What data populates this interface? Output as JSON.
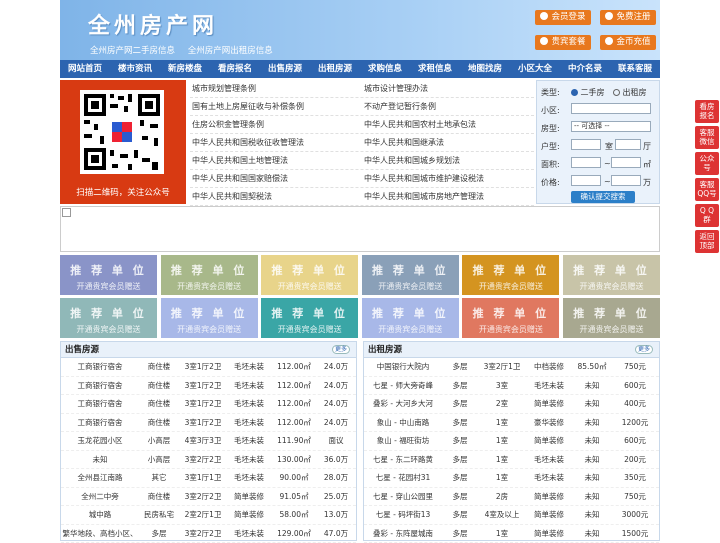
{
  "header": {
    "logo": "全州房产网",
    "taglines": [
      "全州房产网二手房信息",
      "全州房产网出租房信息"
    ],
    "buttons": [
      "会员登录",
      "免费注册",
      "贵宾套餐",
      "金币充值"
    ]
  },
  "nav": [
    "网站首页",
    "楼市资讯",
    "新房楼盘",
    "看房报名",
    "出售房源",
    "出租房源",
    "求购信息",
    "求租信息",
    "地图找房",
    "小区大全",
    "中介名录",
    "联系客服"
  ],
  "qr": {
    "caption": "扫描二维码，关注公众号"
  },
  "links": [
    [
      "城市规划管理条例",
      "城市设计管理办法"
    ],
    [
      "国有土地上房屋征收与补偿条例",
      "不动产登记暂行条例"
    ],
    [
      "住房公积金管理条例",
      "中华人民共和国农村土地承包法"
    ],
    [
      "中华人民共和国税收征收管理法",
      "中华人民共和国继承法"
    ],
    [
      "中华人民共和国土地管理法",
      "中华人民共和国城乡规划法"
    ],
    [
      "中华人民共和国国家赔偿法",
      "中华人民共和国城市维护建设税法"
    ],
    [
      "中华人民共和国契税法",
      "中华人民共和国城市房地产管理法"
    ]
  ],
  "search": {
    "type_label": "类型:",
    "opt1": "二手房",
    "opt2": "出租房",
    "community_label": "小区:",
    "housetype_label": "房型:",
    "select_any": "-- 可选择 --",
    "layout_label": "户型:",
    "room": "室",
    "hall": "厅",
    "area_label": "面积:",
    "area_unit": "㎡",
    "price_label": "价格:",
    "price_unit": "万",
    "submit": "确认提交搜索"
  },
  "ads": {
    "line1": "推 荐 单 位",
    "line2": "开通贵宾会员赠送",
    "colors": [
      "#8a94c8",
      "#a8b88a",
      "#e8d48a",
      "#8aa0b8",
      "#d49420",
      "#c8c4a8",
      "#90b8b8",
      "#a8b8e8",
      "#3aa6a6",
      "#a8b8e8",
      "#e07860",
      "#a8a890"
    ]
  },
  "sale": {
    "title": "出售房源",
    "more": "更多",
    "rows": [
      [
        "工商银行宿舍",
        "商住楼",
        "3室1厅2卫",
        "毛坯未装",
        "112.00㎡",
        "24.0万"
      ],
      [
        "工商银行宿舍",
        "商住楼",
        "3室1厅2卫",
        "毛坯未装",
        "112.00㎡",
        "24.0万"
      ],
      [
        "工商银行宿舍",
        "商住楼",
        "3室1厅2卫",
        "毛坯未装",
        "112.00㎡",
        "24.0万"
      ],
      [
        "工商银行宿舍",
        "商住楼",
        "3室1厅2卫",
        "毛坯未装",
        "112.00㎡",
        "24.0万"
      ],
      [
        "玉龙花园小区",
        "小高层",
        "4室3厅3卫",
        "毛坯未装",
        "111.90㎡",
        "面议"
      ],
      [
        "未知",
        "小高层",
        "3室2厅2卫",
        "毛坯未装",
        "130.00㎡",
        "36.0万"
      ],
      [
        "全州县江南路",
        "其它",
        "3室1厅1卫",
        "毛坯未装",
        "90.00㎡",
        "28.0万"
      ],
      [
        "全州二中旁",
        "商住楼",
        "3室2厅2卫",
        "简单装修",
        "91.05㎡",
        "25.0万"
      ],
      [
        "城中路",
        "民房私宅",
        "2室2厅1卫",
        "简单装修",
        "58.00㎡",
        "13.0万"
      ],
      [
        "繁华地段、高档小区、",
        "多层",
        "3室2厅2卫",
        "毛坯未装",
        "129.00㎡",
        "47.0万"
      ]
    ]
  },
  "rent": {
    "title": "出租房源",
    "more": "更多",
    "rows": [
      [
        "中国银行大院内",
        "多层",
        "3室2厅1卫",
        "中档装修",
        "85.50㎡",
        "750元"
      ],
      [
        "七星 - 师大旁奇峰",
        "多层",
        "3室",
        "毛坯未装",
        "未知",
        "600元"
      ],
      [
        "叠彩 - 大河乡大河",
        "多层",
        "2室",
        "简单装修",
        "未知",
        "400元"
      ],
      [
        "象山 - 中山南路",
        "多层",
        "1室",
        "豪华装修",
        "未知",
        "1200元"
      ],
      [
        "象山 - 福旺街坊",
        "多层",
        "1室",
        "简单装修",
        "未知",
        "600元"
      ],
      [
        "七星 - 东二环路黄",
        "多层",
        "1室",
        "毛坯未装",
        "未知",
        "200元"
      ],
      [
        "七星 - 花园村31",
        "多层",
        "1室",
        "毛坯未装",
        "未知",
        "350元"
      ],
      [
        "七星 - 穿山公园里",
        "多层",
        "2房",
        "简单装修",
        "未知",
        "750元"
      ],
      [
        "七星 - 码坪街13",
        "多层",
        "4室及以上",
        "简单装修",
        "未知",
        "3000元"
      ],
      [
        "叠彩 - 东阵屋城南",
        "多层",
        "1室",
        "简单装修",
        "未知",
        "1500元"
      ]
    ]
  },
  "float": [
    "看房\n报名",
    "客服\n微信",
    "公众\n号",
    "客服\nQQ号",
    "Q Q\n群",
    "返回\n顶部"
  ]
}
